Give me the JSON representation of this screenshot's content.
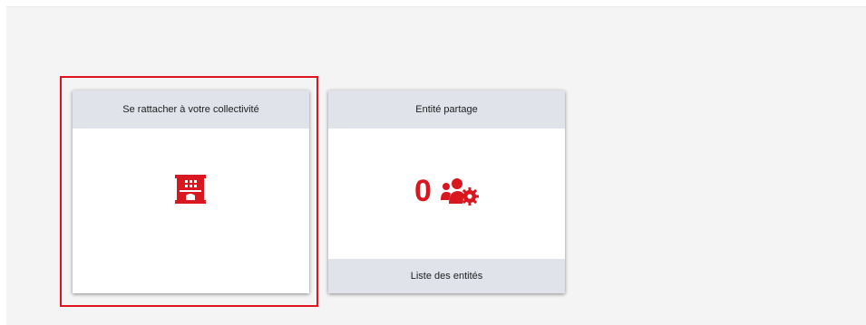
{
  "colors": {
    "accent": "#d8171f",
    "header_bg": "#e0e4ea",
    "page_bg": "#f5f4f5",
    "highlight": "#e0141e"
  },
  "cards": {
    "rattacher": {
      "title": "Se rattacher à votre collectivité",
      "icon": "building-icon"
    },
    "entite": {
      "title": "Entité partage",
      "count": "0",
      "icon": "users-cog-icon",
      "footer_label": "Liste des entités"
    }
  }
}
